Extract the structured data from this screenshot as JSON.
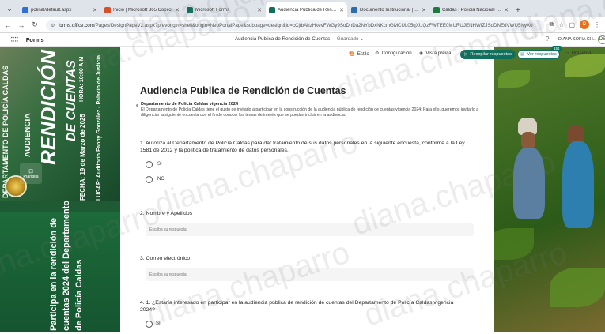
{
  "browser": {
    "tabs": [
      {
        "label": "polinal/default.aspx",
        "color": "#2f6fd6",
        "active": false
      },
      {
        "label": "Inicio | Microsoft 365 Copilot",
        "color": "#d94f2b",
        "active": false
      },
      {
        "label": "Microsoft Forms",
        "color": "#0e6f5c",
        "active": false
      },
      {
        "label": "Audiencia Publica de Rendición",
        "color": "#0e6f5c",
        "active": true
      },
      {
        "label": "Documento Institucional | Copilot",
        "color": "#2b6cb0",
        "active": false
      },
      {
        "label": "Caldas | Policía Nacional de Co…",
        "color": "#1e7a3c",
        "active": false
      }
    ],
    "url_domain": "forms.office.com",
    "url_rest": "/Pages/DesignPageV2.aspx?prevorigin=shell&origin=NeoPortalPage&subpage=design&id=cCjtbAhzHkevFWGy9SoDnDa2NYbDxNKcmGMCUL05qXUQzFWTEE0MURUJENHWIZJSdDNEdVWU5NyXu",
    "profile_initial": "D"
  },
  "app": {
    "name": "Forms",
    "doc_title": "Audiencia Publica de Rendición de Cuentas",
    "saved_label": "Guardado",
    "user_name": "DIANA SOFIA CH...",
    "user_initial": "DS"
  },
  "toolbar": {
    "estilo": "Estilo",
    "configuracion": "Configuración",
    "vista_previa": "Vista previa",
    "recopilar": "Recopilar respuestas",
    "ver_respuestas": "Ver respuestas",
    "responses_count": "154",
    "presentar": "Presentar"
  },
  "banner": {
    "plantilla_label": "Plantilla",
    "lines": [
      "DEPARTAMENTO DE POLICÍA CALDAS",
      "AUDIENCIA",
      "RENDICIÓN",
      "DE CUENTAS",
      "FECHA: 19 de Marzo de 2025",
      "HORA: 10:00 A.M",
      "LUGAR: Auditorio Fanny González - Palacio de Justicia"
    ],
    "bottom_lines": [
      "Participa en la rendición de",
      "cuentas 2024 del Departamento",
      "de Policía Caldas"
    ]
  },
  "form": {
    "title": "Audiencia Publica de Rendición de Cuentas",
    "section_title": "Departamento de Policía Caldas vigencia 2024",
    "description": "El Departamento de Policía Caldas tiene el gusto de invitarlo a participar en la construcción de la audiencia pública de rendición de cuentas vigencia 2024; Para ello, queremos invitarlo a diligenciar la siguiente encuesta con el fin de conocer los temas de interés que se puedan incluir en la audiencia.",
    "q1": "1. Autoriza al Departamento de Policía Caldas para dar tratamiento de sus datos personales en la siguiente encuesta, conforme a la Ley 1581 de 2012 y la política de tratamiento de datos personales.",
    "q1_opt_si": "SI",
    "q1_opt_no": "NO",
    "q2": "2. Nombre y Apellidos",
    "q2_placeholder": "Escriba su respuesta",
    "q3": "3. Correo electrónico",
    "q3_placeholder": "Escriba su respuesta",
    "q4": "4. 1.      ¿Estaría interesado en participar en la audiencia pública de rendición de cuentas del Departamento de Policía Caldas vigencia 2024?",
    "q4_opt_si": "SI"
  },
  "watermark": "diana.chaparro"
}
